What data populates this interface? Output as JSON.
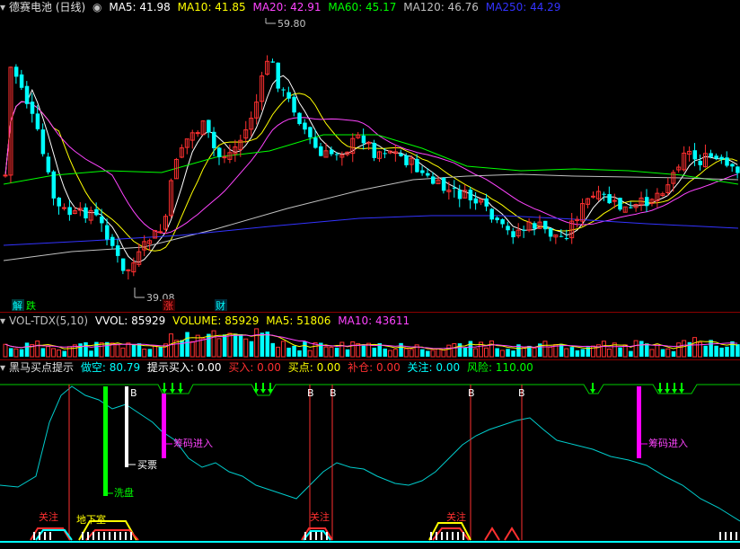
{
  "main_header": {
    "stock": "德赛电池 (日线)",
    "ma": [
      {
        "label": "MA5: 41.98",
        "color": "#ffffff"
      },
      {
        "label": "MA10: 41.85",
        "color": "#ffff00"
      },
      {
        "label": "MA20: 42.91",
        "color": "#ff44ff"
      },
      {
        "label": "MA60: 45.17",
        "color": "#00ff00"
      },
      {
        "label": "MA120: 46.76",
        "color": "#c0c0c0"
      },
      {
        "label": "MA250: 44.29",
        "color": "#3333ff"
      }
    ]
  },
  "price_labels": {
    "high": "59.80",
    "low": "39.08"
  },
  "event_tags": [
    {
      "text": "解",
      "color": "#00ffff"
    },
    {
      "text": "跌",
      "color": "#00ff00"
    },
    {
      "text": "涨",
      "color": "#ff3030"
    },
    {
      "text": "财",
      "color": "#00ffff"
    }
  ],
  "vol_header": {
    "name": "VOL-TDX(5,10)",
    "items": [
      {
        "label": "VVOL: 85929",
        "color": "#ffffff"
      },
      {
        "label": "VOLUME: 85929",
        "color": "#ffff00"
      },
      {
        "label": "MA5: 51806",
        "color": "#ffff00"
      },
      {
        "label": "MA10: 43611",
        "color": "#ff44ff"
      }
    ]
  },
  "ind_header": {
    "name": "黑马买点提示",
    "items": [
      {
        "label": "做空: 80.79",
        "color": "#00ffff"
      },
      {
        "label": "提示买入: 0.00",
        "color": "#ffffff"
      },
      {
        "label": "买入: 0.00",
        "color": "#ff3030"
      },
      {
        "label": "买点: 0.00",
        "color": "#ffff00"
      },
      {
        "label": "补仓: 0.00",
        "color": "#ff3030"
      },
      {
        "label": "关注: 0.00",
        "color": "#00ffff"
      },
      {
        "label": "风险: 110.00",
        "color": "#00ff00"
      }
    ]
  },
  "ind_labels": {
    "xipan": "洗盘",
    "maipiao": "买票",
    "chouma1": "筹码进入",
    "chouma2": "筹码进入",
    "guanzhu1": "关注",
    "dixiashi": "地下室",
    "guanzhu2": "关注",
    "guanzhu3": "关注",
    "b": "B"
  },
  "colors": {
    "up": "#ff3030",
    "down": "#00ffff",
    "bg": "#000000",
    "separator": "#8b0000"
  }
}
